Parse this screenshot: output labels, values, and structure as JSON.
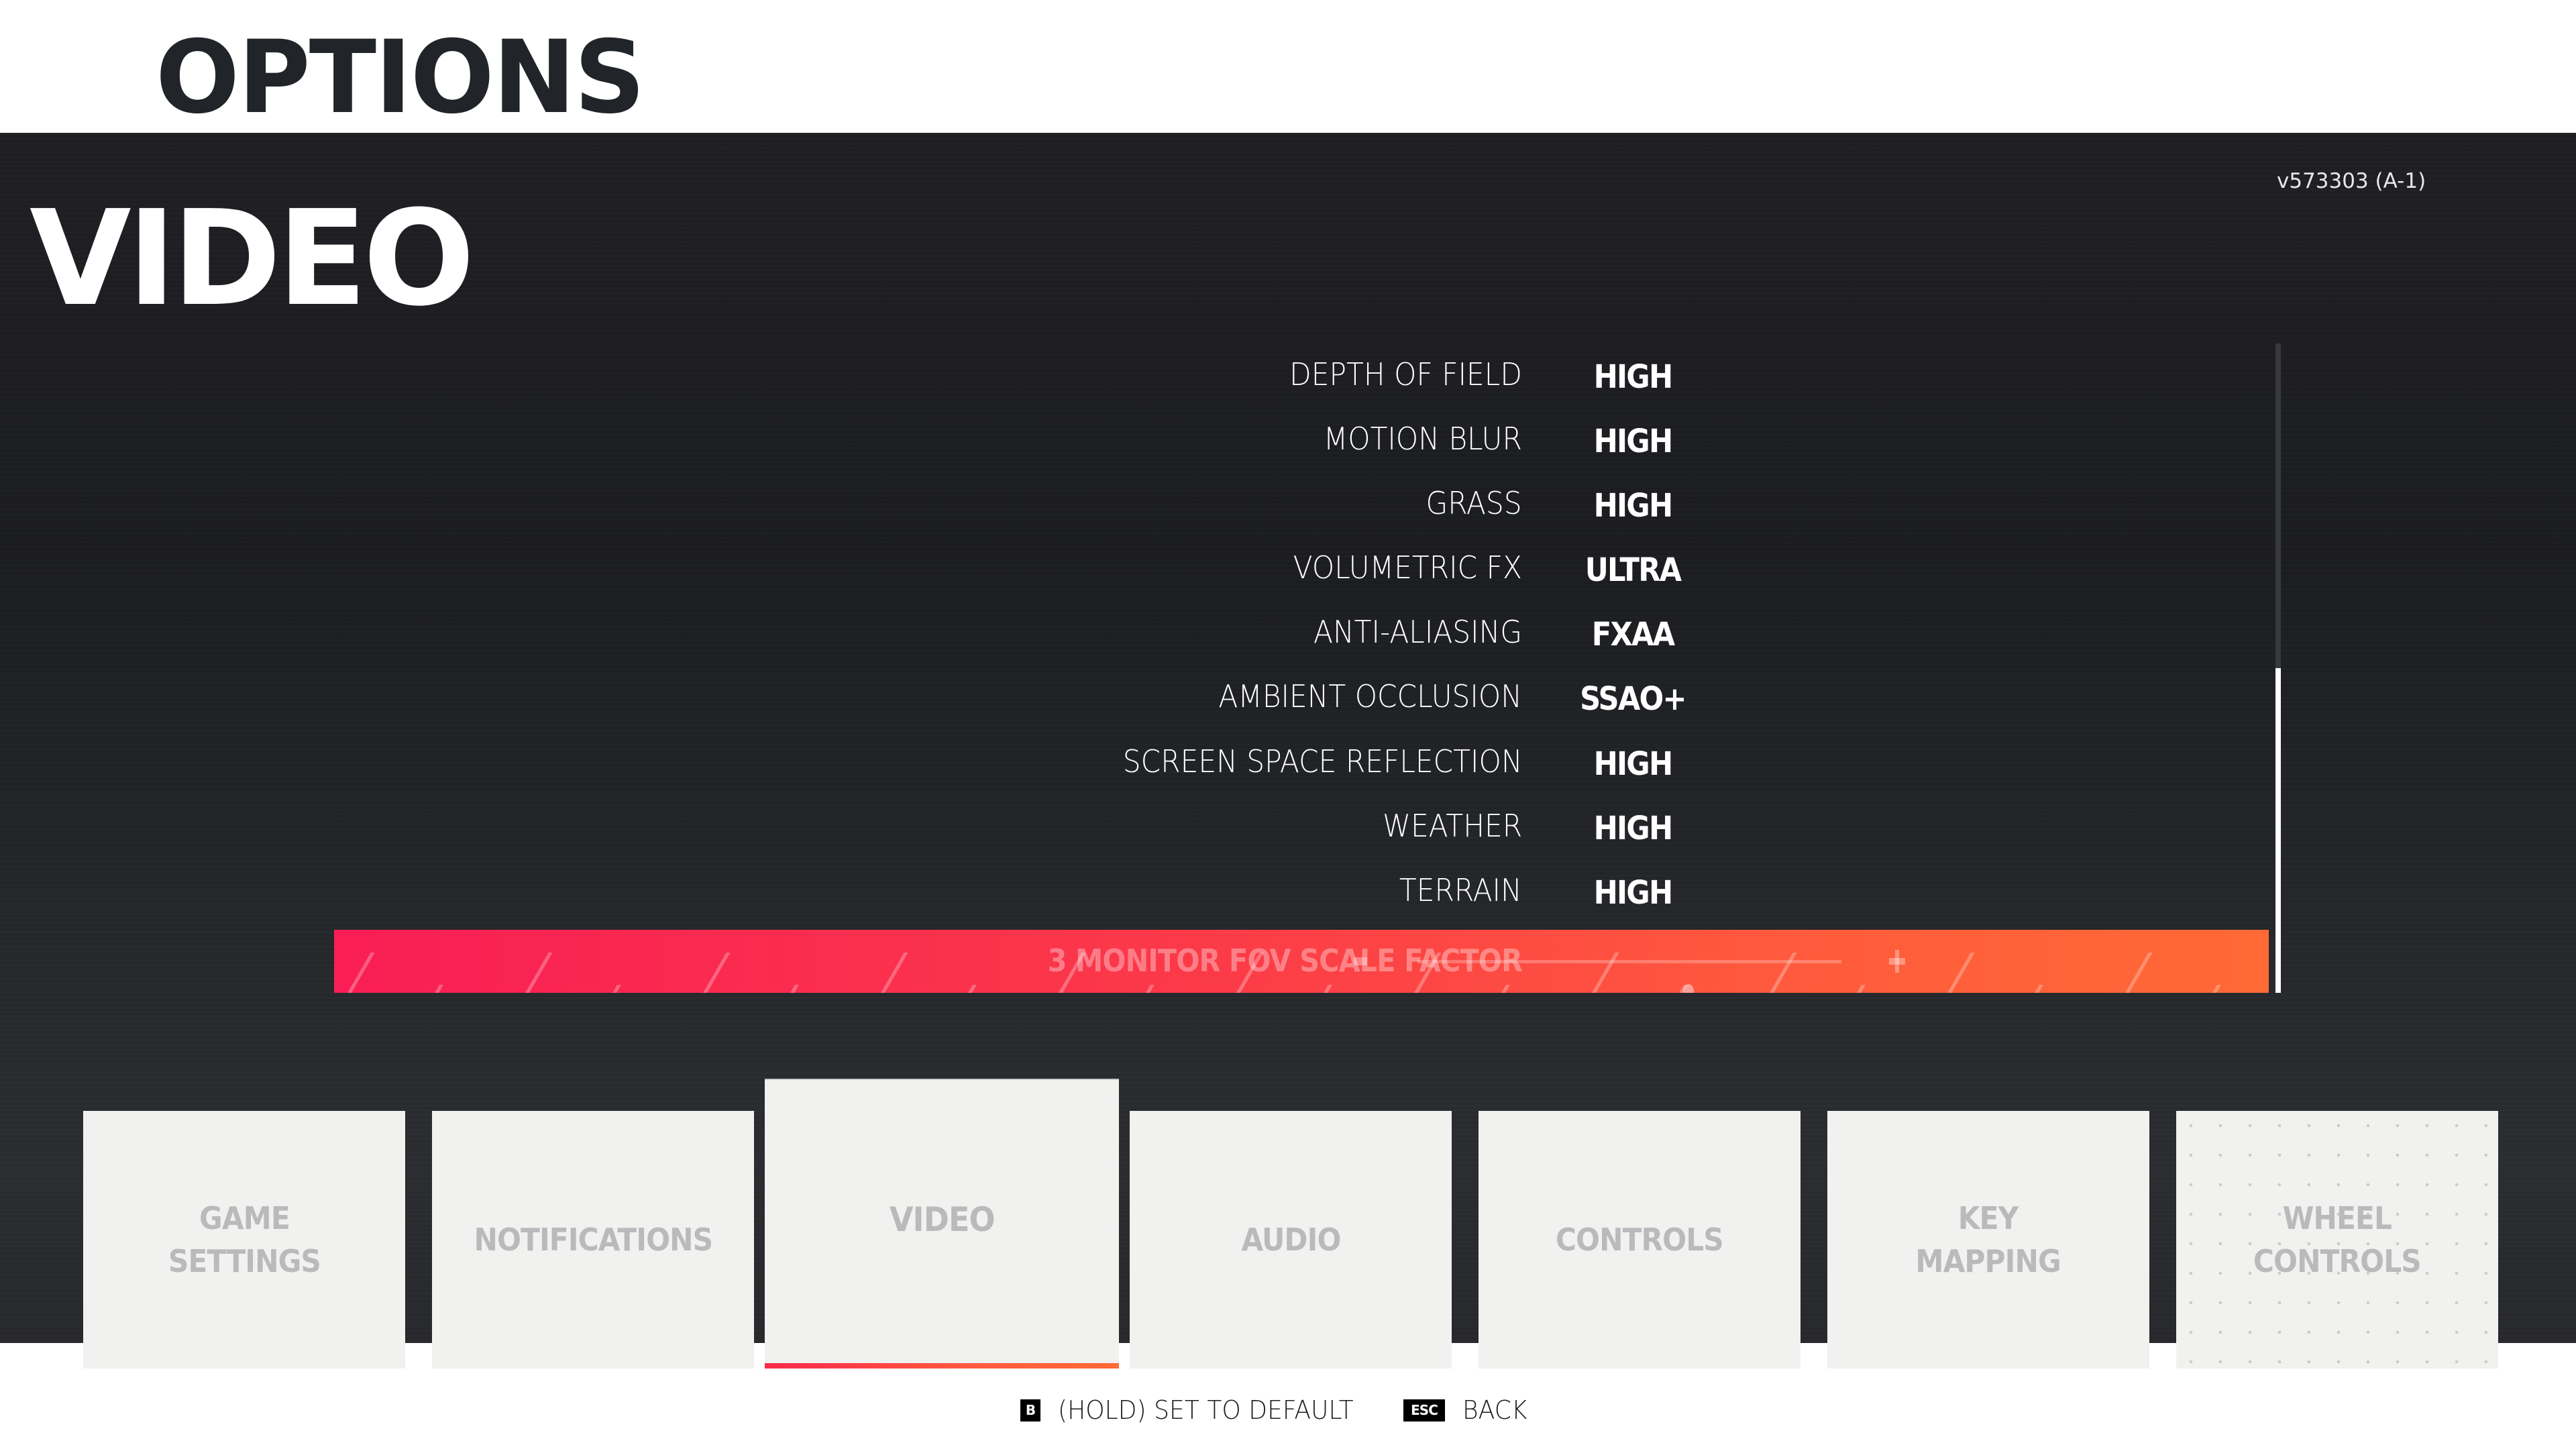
{
  "header": {
    "title": "OPTIONS"
  },
  "page": {
    "section_title": "VIDEO",
    "version": "v573303 (A-1)"
  },
  "settings": [
    {
      "label": "DEPTH OF FIELD",
      "value": "HIGH"
    },
    {
      "label": "MOTION BLUR",
      "value": "HIGH"
    },
    {
      "label": "GRASS",
      "value": "HIGH"
    },
    {
      "label": "VOLUMETRIC FX",
      "value": "ULTRA"
    },
    {
      "label": "ANTI-ALIASING",
      "value": "FXAA"
    },
    {
      "label": "AMBIENT OCCLUSION",
      "value": "SSAO+"
    },
    {
      "label": "SCREEN SPACE REFLECTION",
      "value": "HIGH"
    },
    {
      "label": "WEATHER",
      "value": "HIGH"
    },
    {
      "label": "TERRAIN",
      "value": "HIGH"
    }
  ],
  "selected_setting": {
    "label": "3 MONITOR FOV SCALE FACTOR",
    "type": "slider",
    "slider_fraction": 0.64,
    "minus_icon": "minus-icon",
    "plus_icon": "plus-icon"
  },
  "scrollbar": {
    "thumb_start_fraction": 0.5,
    "thumb_end_fraction": 1.0
  },
  "tabs": [
    {
      "label": "GAME\nSETTINGS",
      "state": "normal"
    },
    {
      "label": "NOTIFICATIONS",
      "state": "normal"
    },
    {
      "label": "VIDEO",
      "state": "active"
    },
    {
      "label": "AUDIO",
      "state": "normal"
    },
    {
      "label": "CONTROLS",
      "state": "normal"
    },
    {
      "label": "KEY\nMAPPING",
      "state": "normal"
    },
    {
      "label": "WHEEL\nCONTROLS",
      "state": "disabled"
    }
  ],
  "footer": {
    "hints": [
      {
        "key": "B",
        "label": "(HOLD) SET TO DEFAULT"
      },
      {
        "key": "ESC",
        "label": "BACK"
      }
    ]
  },
  "colors": {
    "accent_start": "#f91e55",
    "accent_end": "#ff6a35",
    "background_dark": "#202024",
    "header_bg": "#ffffff",
    "title_dark": "#212428",
    "tab_bg": "#f1f1ef",
    "tab_text": "#b9babc"
  }
}
